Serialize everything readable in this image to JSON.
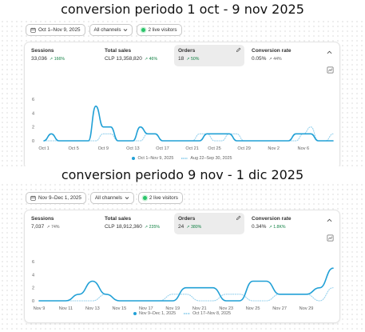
{
  "headings": [
    "conversion periodo 1 oct - 9 nov 2025",
    "conversion periodo  9 nov - 1 dic 2025"
  ],
  "colors": {
    "current": "#21a0d6",
    "previous": "#9ad3ee",
    "positive": "#108043",
    "live": "#29c46a"
  },
  "panels": [
    {
      "date_range": "Oct 1–Nov 9, 2025",
      "channels": "All channels",
      "live": "2 live visitors",
      "metrics": [
        {
          "label": "Sessions",
          "value": "33,036",
          "change": "166%",
          "trend": "up"
        },
        {
          "label": "Total sales",
          "value": "CLP 13,358,820",
          "change": "46%",
          "trend": "up"
        },
        {
          "label": "Orders",
          "value": "18",
          "change": "50%",
          "trend": "up"
        },
        {
          "label": "Conversion rate",
          "value": "0.05%",
          "change": "44%",
          "trend": "neutral"
        }
      ],
      "legend": [
        "Oct 1–Nov 9, 2025",
        "Aug 22–Sep 30, 2025"
      ]
    },
    {
      "date_range": "Nov 9–Dec 1, 2025",
      "channels": "All channels",
      "live": "2 live visitors",
      "metrics": [
        {
          "label": "Sessions",
          "value": "7,037",
          "change": "74%",
          "trend": "neutral"
        },
        {
          "label": "Total sales",
          "value": "CLP 18,912,360",
          "change": "235%",
          "trend": "up"
        },
        {
          "label": "Orders",
          "value": "24",
          "change": "380%",
          "trend": "up"
        },
        {
          "label": "Conversion rate",
          "value": "0.34%",
          "change": "1.8K%",
          "trend": "up"
        }
      ],
      "legend": [
        "Nov 9–Dec 1, 2025",
        "Oct 17–Nov 8, 2025"
      ]
    }
  ],
  "chart_data": [
    {
      "type": "line",
      "title": "",
      "xlabel": "",
      "ylabel": "",
      "ylim": [
        0,
        6
      ],
      "yticks": [
        0,
        2,
        4,
        6
      ],
      "x_tick_labels": [
        "Oct 1",
        "Oct 5",
        "Oct 9",
        "Oct 13",
        "Oct 17",
        "Oct 21",
        "Oct 25",
        "Oct 29",
        "Nov 2",
        "Nov 6"
      ],
      "grid": false,
      "series": [
        {
          "name": "Oct 1–Nov 9, 2025",
          "values": [
            0,
            1,
            0,
            0,
            0,
            0,
            0,
            5,
            2,
            2,
            0,
            0,
            0,
            2,
            1,
            1,
            0,
            0,
            0,
            0,
            0,
            0,
            1,
            1,
            1,
            1,
            0,
            0,
            0,
            0,
            0,
            0,
            0,
            0,
            1,
            1,
            1,
            0,
            0,
            0
          ]
        },
        {
          "name": "Aug 22–Sep 30, 2025",
          "values": [
            0,
            0,
            0,
            0,
            0,
            0,
            0,
            0,
            1,
            1,
            0,
            0,
            0,
            0,
            1,
            1,
            0,
            0,
            0,
            0,
            0,
            1,
            1,
            0,
            0,
            1,
            1,
            0,
            0,
            0,
            0,
            0,
            0,
            0,
            0,
            1,
            2,
            0,
            0,
            1
          ]
        }
      ]
    },
    {
      "type": "line",
      "title": "",
      "xlabel": "",
      "ylabel": "",
      "ylim": [
        0,
        6
      ],
      "yticks": [
        0,
        2,
        4,
        6
      ],
      "x_tick_labels": [
        "Nov 9",
        "Nov 11",
        "Nov 13",
        "Nov 15",
        "Nov 17",
        "Nov 19",
        "Nov 21",
        "Nov 23",
        "Nov 25",
        "Nov 27",
        "Nov 29"
      ],
      "grid": false,
      "series": [
        {
          "name": "Nov 9–Dec 1, 2025",
          "values": [
            0,
            0,
            0,
            1,
            3,
            1,
            0,
            0,
            0,
            0,
            0,
            2,
            2,
            2,
            0,
            0,
            3,
            3,
            1,
            1,
            1,
            2,
            5
          ]
        },
        {
          "name": "Oct 17–Nov 8, 2025",
          "values": [
            0,
            0,
            0,
            0,
            0,
            1,
            0,
            0,
            0,
            0,
            1,
            1,
            0,
            0,
            1,
            1,
            0,
            0,
            1,
            1,
            1,
            0,
            2
          ]
        }
      ]
    }
  ]
}
